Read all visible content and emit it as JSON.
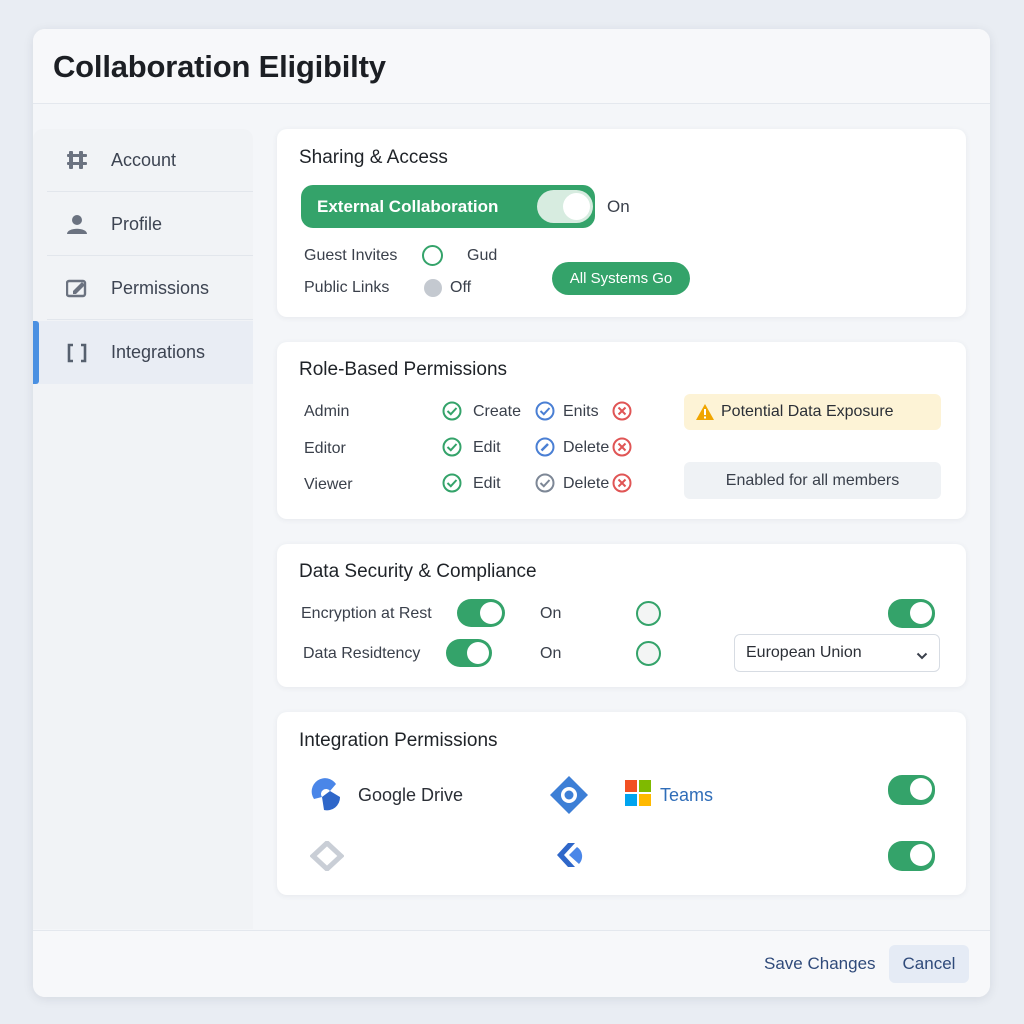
{
  "header": {
    "title": "Collaboration Eligibilty"
  },
  "sidebar": {
    "items": [
      {
        "label": "Account",
        "icon": "grid-icon"
      },
      {
        "label": "Profile",
        "icon": "user-icon"
      },
      {
        "label": "Permissions",
        "icon": "edit-document-icon"
      },
      {
        "label": "Integrations",
        "icon": "brackets-icon",
        "active": true
      }
    ]
  },
  "sharing": {
    "title": "Sharing & Access",
    "external_label": "External Collaboration",
    "external_state": "On",
    "guest_label": "Guest Invites",
    "guest_value": "Gud",
    "public_label": "Public Links",
    "public_value": "Off",
    "status_badge": "All Systems Go"
  },
  "roles": {
    "title": "Role-Based Permissions",
    "rows": [
      {
        "role": "Admin",
        "perm1": "Create",
        "perm2": "Enits"
      },
      {
        "role": "Editor",
        "perm1": "Edit",
        "perm2": "Delete"
      },
      {
        "role": "Viewer",
        "perm1": "Edit",
        "perm2": "Delete"
      }
    ],
    "warning": "Potential Data Exposure",
    "note": "Enabled for all members"
  },
  "security": {
    "title": "Data Security & Compliance",
    "encryption_label": "Encryption at Rest",
    "encryption_state": "On",
    "residency_label": "Data Residtency",
    "residency_state": "On",
    "region_selected": "European Union"
  },
  "integrations": {
    "title": "Integration Permissions",
    "google_drive": "Google Drive",
    "teams": "Teams"
  },
  "footer": {
    "save_label": "Save Changes",
    "cancel_label": "Cancel"
  },
  "colors": {
    "accent_green": "#34a36a",
    "accent_blue": "#4a90e2",
    "warning_bg": "#fdf3d6",
    "error_red": "#e05555"
  }
}
